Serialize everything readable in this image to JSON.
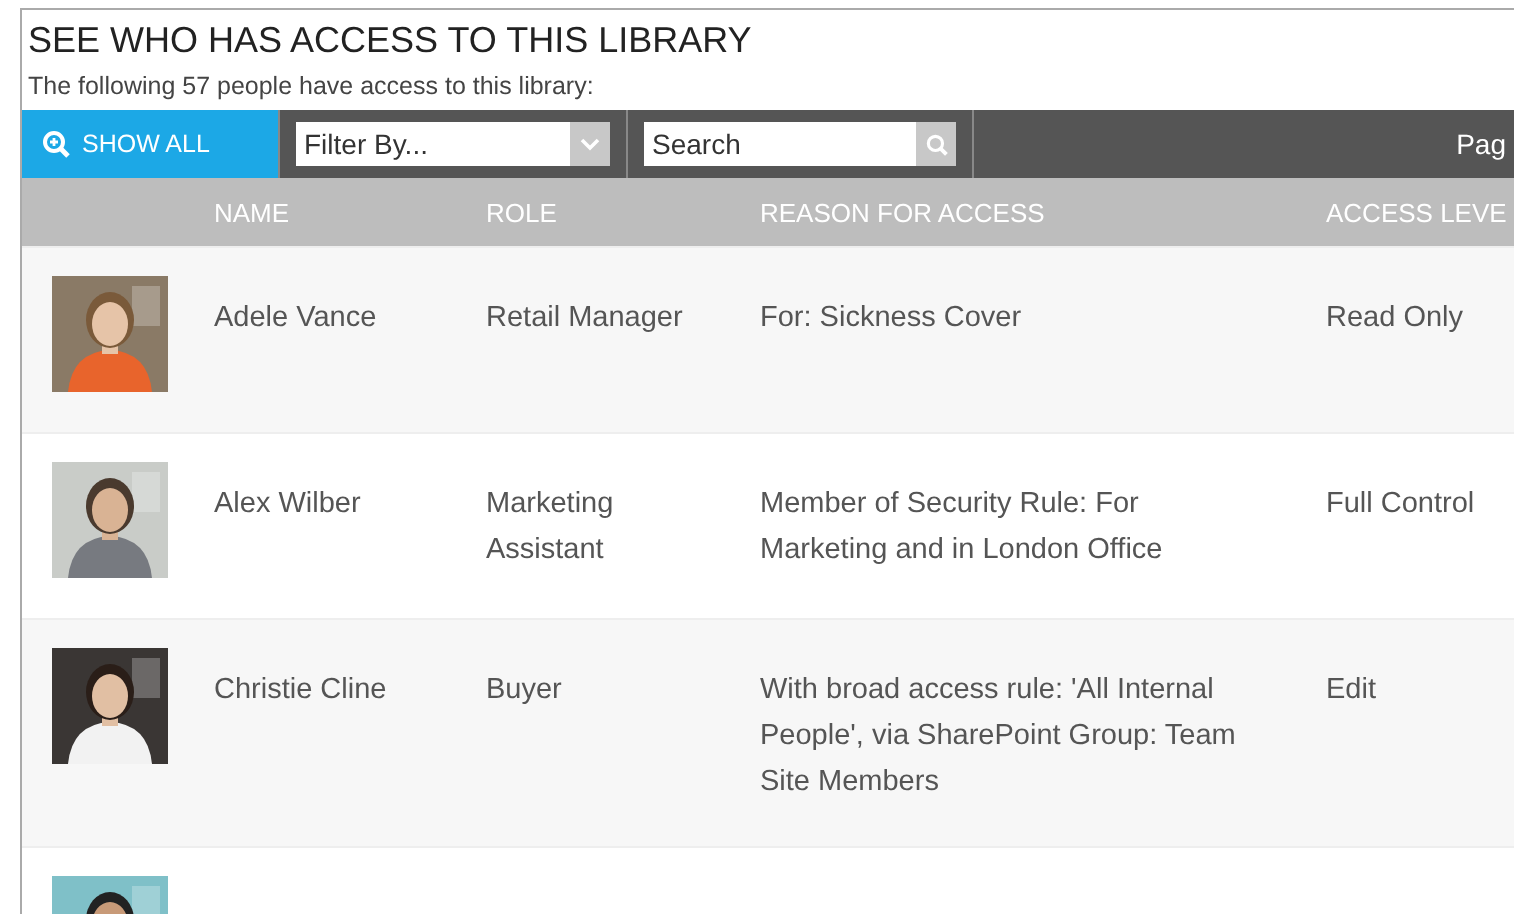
{
  "title": "SEE WHO HAS ACCESS TO THIS LIBRARY",
  "subtitle": "The following 57 people have access to this library:",
  "toolbar": {
    "show_all": "SHOW ALL",
    "filter": {
      "placeholder": "Filter By..."
    },
    "search": {
      "placeholder": "Search"
    },
    "paging": "Pag"
  },
  "table": {
    "columns": [
      "NAME",
      "ROLE",
      "REASON FOR ACCESS",
      "ACCESS LEVE"
    ],
    "rows": [
      {
        "avatar": {
          "kind": "picture"
        },
        "name": "Adele Vance",
        "role": "Retail Manager",
        "reason": "For: Sickness Cover",
        "access": "Read Only"
      },
      {
        "avatar": {
          "kind": "picture"
        },
        "name": "Alex Wilber",
        "role": "Marketing Assistant",
        "reason": "Member of Security Rule: For Marketing and in London Office",
        "access": "Full Control"
      },
      {
        "avatar": {
          "kind": "picture"
        },
        "name": "Christie Cline",
        "role": "Buyer",
        "reason": "With broad access rule: 'All Internal People', via SharePoint Group: Team Site Members",
        "access": "Edit"
      },
      {
        "avatar": {
          "kind": "picture"
        }
      }
    ]
  }
}
